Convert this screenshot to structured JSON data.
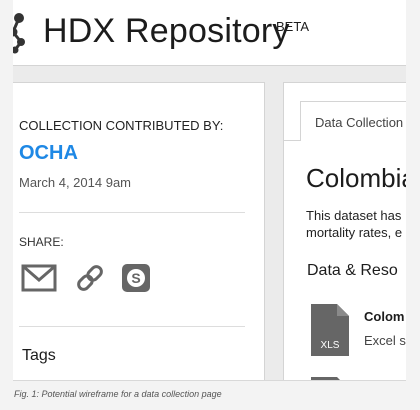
{
  "header": {
    "title": "HDX Repository",
    "badge": "BETA"
  },
  "collection": {
    "contributed_by_label": "COLLECTION CONTRIBUTED BY:",
    "organization": "OCHA",
    "date": "March 4, 2014 9am"
  },
  "share": {
    "label": "SHARE:",
    "icons": [
      "email-icon",
      "link-icon",
      "skype-icon"
    ]
  },
  "tags": {
    "label": "Tags"
  },
  "tabs": [
    {
      "label": "Data Collection"
    }
  ],
  "dataset": {
    "title": "Colombia",
    "description_line1": "This dataset has",
    "description_line2": "mortality rates, e"
  },
  "resources": {
    "heading": "Data & Reso",
    "items": [
      {
        "name": "Colom",
        "type": "Excel s",
        "format": "XLS"
      }
    ]
  },
  "caption": "Fig. 1:  Potential wireframe for a data collection page",
  "colors": {
    "accent": "#1e88e5",
    "icon_gray": "#666666"
  }
}
